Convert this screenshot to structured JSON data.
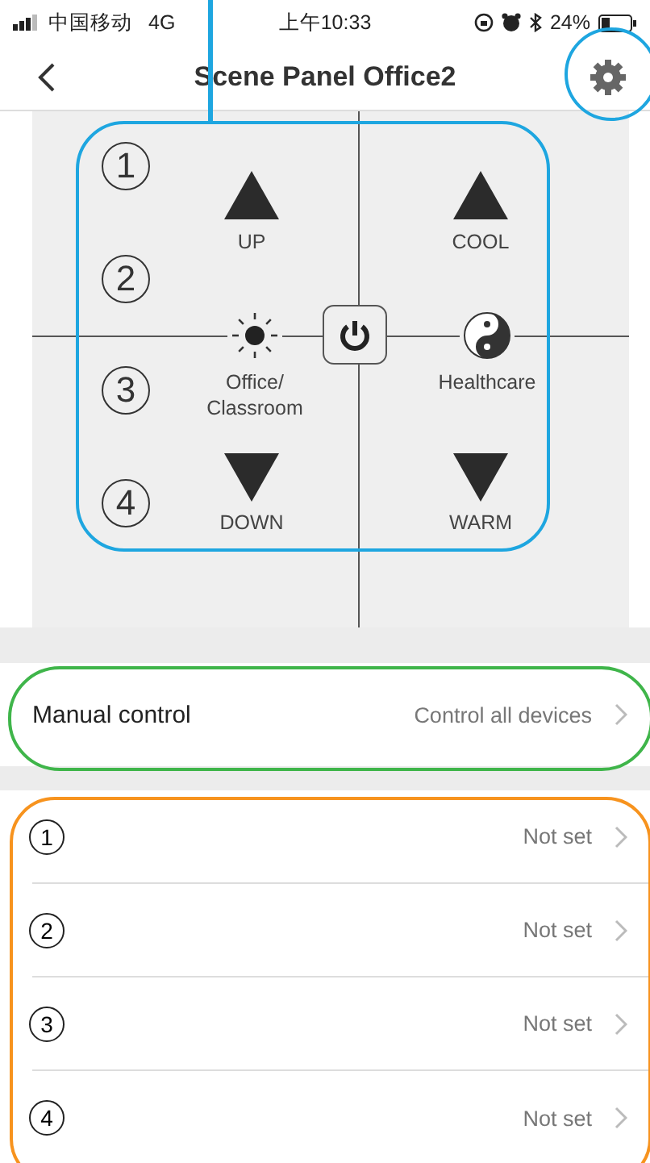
{
  "status_bar": {
    "carrier": "中国移动",
    "network": "4G",
    "time": "上午10:33",
    "battery": "24%"
  },
  "nav": {
    "title": "Scene Panel Office2"
  },
  "panel": {
    "numbers": [
      "1",
      "2",
      "3",
      "4"
    ],
    "keys": [
      {
        "kind": "up",
        "label": "UP"
      },
      {
        "kind": "up",
        "label": "COOL"
      },
      {
        "kind": "sun",
        "label": "Office/ Classroom"
      },
      {
        "kind": "yinyang",
        "label": "Healthcare"
      },
      {
        "kind": "down",
        "label": "DOWN"
      },
      {
        "kind": "down",
        "label": "WARM"
      }
    ]
  },
  "manual": {
    "label": "Manual control",
    "value": "Control all devices"
  },
  "scenes": [
    {
      "number": "1",
      "value": "Not set"
    },
    {
      "number": "2",
      "value": "Not set"
    },
    {
      "number": "3",
      "value": "Not set"
    },
    {
      "number": "4",
      "value": "Not set"
    }
  ]
}
